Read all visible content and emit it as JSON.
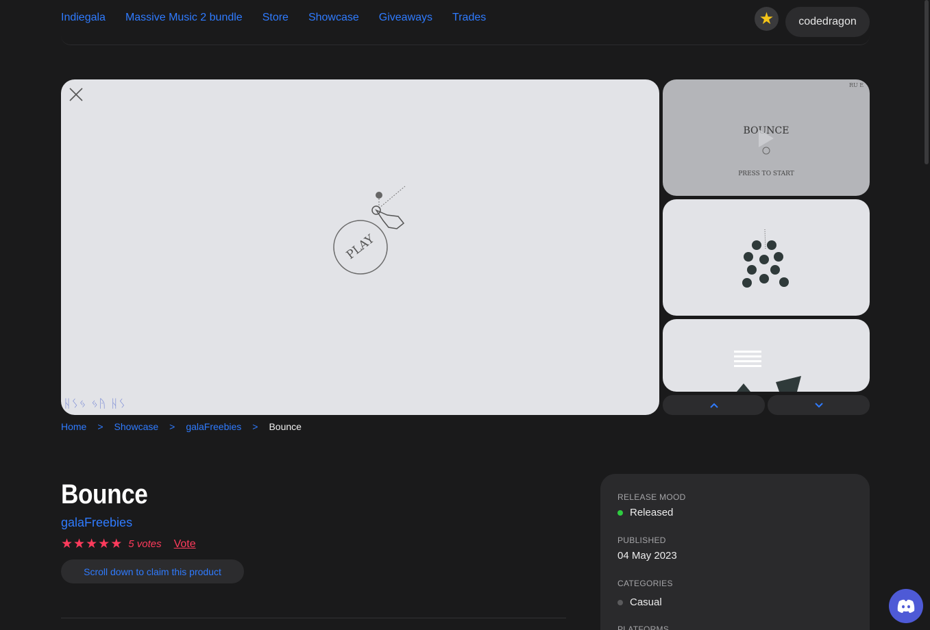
{
  "nav": {
    "items": [
      "Indiegala",
      "Massive Music 2 bundle",
      "Store",
      "Showcase",
      "Giveaways",
      "Trades"
    ],
    "username": "codedragon"
  },
  "viewer": {
    "play_text": "PLAY",
    "watermark": "ᚺᛊᛃ ᛃᚤ ᚺᛊ"
  },
  "thumbnails": {
    "thumb1_title": "BOUNCE",
    "thumb1_subtitle": "PRESS TO START",
    "thumb1_corner": "RU E"
  },
  "breadcrumb": {
    "home": "Home",
    "showcase": "Showcase",
    "developer": "galaFreebies",
    "current": "Bounce",
    "separator": ">"
  },
  "product": {
    "title": "Bounce",
    "developer": "galaFreebies",
    "stars": 5,
    "votes": "5 votes",
    "vote_label": "Vote",
    "claim_label": "Scroll down to claim this product"
  },
  "info": {
    "release_mood_label": "RELEASE MOOD",
    "release_mood_value": "Released",
    "published_label": "PUBLISHED",
    "published_value": "04 May 2023",
    "categories_label": "CATEGORIES",
    "categories_value": "Casual",
    "platforms_label": "PLATFORMS"
  },
  "colors": {
    "accent": "#2f7bff",
    "rating": "#ff3b5c",
    "released_dot": "#2ecc40"
  },
  "icons": [
    "star-badge-icon",
    "close-icon",
    "chevron-up-icon",
    "chevron-down-icon",
    "star-icon",
    "discord-icon"
  ]
}
